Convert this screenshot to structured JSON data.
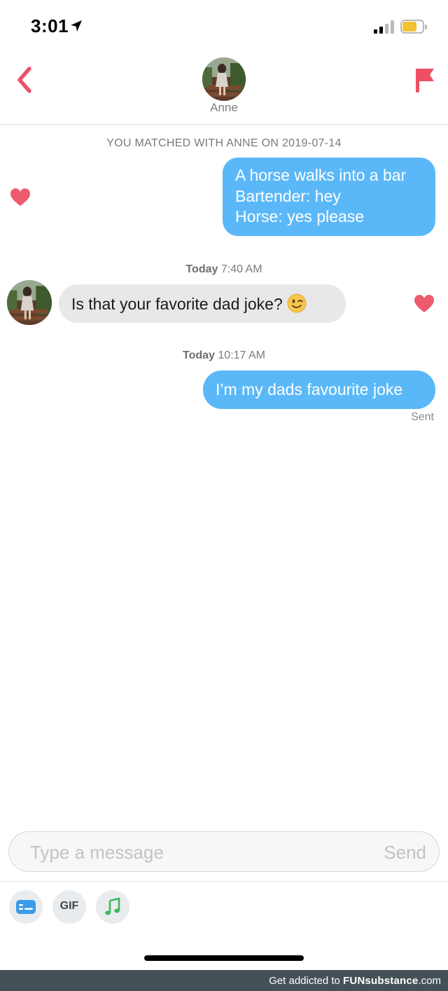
{
  "status_bar": {
    "time": "3:01",
    "icons": [
      "location-arrow-icon",
      "cellular-signal-icon",
      "battery-icon"
    ],
    "battery_color": "#f2c230"
  },
  "header": {
    "contact_name": "Anne",
    "back_icon": "chevron-left-icon",
    "report_icon": "flag-icon",
    "accent_color": "#ef4f62"
  },
  "conversation": {
    "match_banner": "YOU MATCHED WITH ANNE ON 2019-07-14",
    "messages": [
      {
        "direction": "outgoing",
        "lines": [
          "A horse walks into a bar",
          "Bartender: hey",
          "Horse: yes please"
        ],
        "liked": true
      },
      {
        "direction": "incoming",
        "timestamp_day": "Today",
        "timestamp_time": "7:40 AM",
        "text": "Is that your favorite dad joke?",
        "emoji": "wink-emoji",
        "liked": true
      },
      {
        "direction": "outgoing",
        "timestamp_day": "Today",
        "timestamp_time": "10:17 AM",
        "text": "I’m my dads favourite joke",
        "status": "Sent"
      }
    ],
    "outgoing_bubble_color": "#5bb8f8",
    "incoming_bubble_color": "#e8e8e8",
    "heart_color": "#ef5b6e"
  },
  "composer": {
    "placeholder": "Type a message",
    "value": "",
    "send_label": "Send"
  },
  "toolbar": {
    "items": [
      {
        "icon": "card-icon"
      },
      {
        "label": "GIF"
      },
      {
        "icon": "music-note-icon"
      }
    ]
  },
  "watermark": {
    "prefix": "Get addicted to",
    "brand": "FUNsubstance",
    "suffix": ".com"
  }
}
